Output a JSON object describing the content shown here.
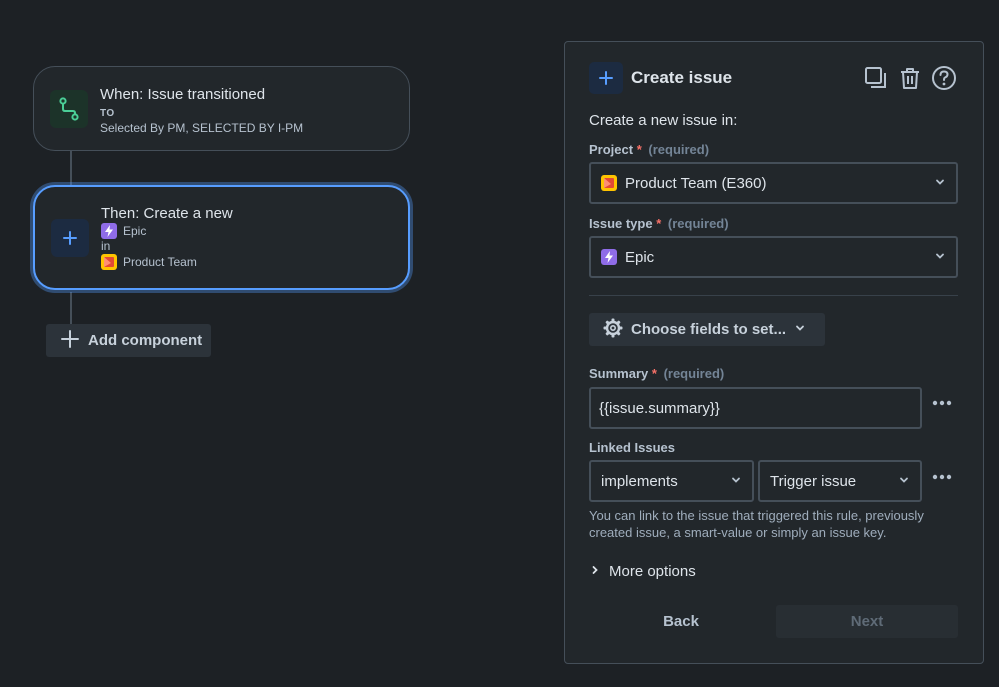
{
  "flow": {
    "trigger": {
      "title": "When: Issue transitioned",
      "to_label": "TO",
      "detail": "Selected By PM, SELECTED BY I-PM",
      "icon": "transition-icon"
    },
    "action": {
      "title": "Then: Create a new",
      "issue_type": "Epic",
      "in_label": "in",
      "project": "Product Team",
      "icon": "plus-icon"
    },
    "add_component_label": "Add component"
  },
  "panel": {
    "title": "Create issue",
    "intro": "Create a new issue in:",
    "icons": [
      "copy-icon",
      "trash-icon",
      "help-icon"
    ],
    "project": {
      "label": "Project",
      "required_mark": "*",
      "hint": "(required)",
      "value": "Product Team (E360)"
    },
    "issue_type": {
      "label": "Issue type",
      "required_mark": "*",
      "hint": "(required)",
      "value": "Epic"
    },
    "choose_fields_label": "Choose fields to set...",
    "summary": {
      "label": "Summary",
      "required_mark": "*",
      "hint": "(required)",
      "value": "{{issue.summary}}"
    },
    "linked_issues": {
      "label": "Linked Issues",
      "link_type": "implements",
      "target": "Trigger issue",
      "helper": "You can link to the issue that triggered this rule, previously created issue, a smart-value or simply an issue key."
    },
    "more_options_label": "More options",
    "back_label": "Back",
    "next_label": "Next"
  },
  "colors": {
    "background": "#1d2125",
    "surface": "#22272b",
    "border": "#454f59",
    "focus": "#579dff",
    "epic": "#8f6ce8",
    "project": "#ffc400",
    "required": "#f87168"
  }
}
